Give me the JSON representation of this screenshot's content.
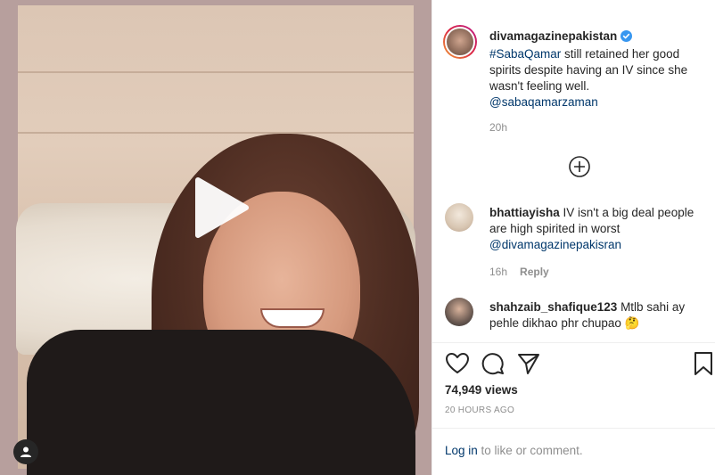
{
  "post": {
    "username": "divamagazinepakistan",
    "caption_hashtag": "#SabaQamar",
    "caption_text": " still retained her good spirits despite having an IV since she wasn't feeling well.",
    "caption_mention": "@sabaqamarzaman",
    "time": "20h"
  },
  "comments": [
    {
      "username": "bhattiayisha",
      "text": " IV isn't a big deal people are high spirited in worst",
      "mention": "@divamagazinepakisran",
      "time": "16h",
      "reply_label": "Reply"
    },
    {
      "username": "shahzaib_shafique123",
      "text": " Mtlb sahi ay pehle dikhao phr chupao 🤔"
    }
  ],
  "stats": {
    "views": "74,949 views",
    "ago": "20 HOURS AGO"
  },
  "footer": {
    "login_link": "Log in",
    "login_text": " to like or comment."
  },
  "icons": {
    "verified": "verified-badge-icon",
    "play": "play-icon",
    "user_tag": "user-tag-icon",
    "load_more": "plus-circle-icon",
    "like": "heart-icon",
    "comment": "comment-bubble-icon",
    "share": "paper-plane-icon",
    "save": "bookmark-icon"
  },
  "colors": {
    "link": "#00376b",
    "verified": "#3897f0",
    "muted": "#8e8e8e"
  }
}
